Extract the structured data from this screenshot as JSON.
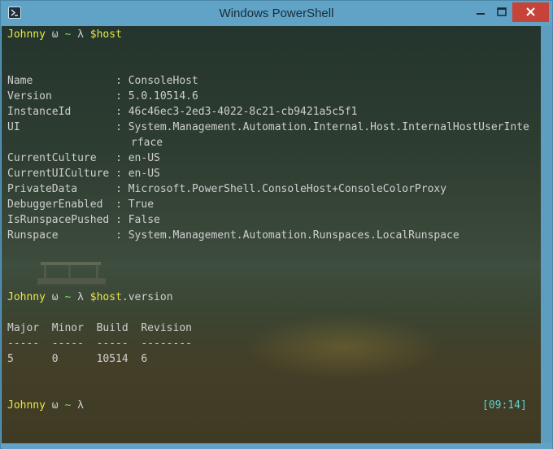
{
  "window": {
    "title": "Windows PowerShell"
  },
  "prompt": {
    "user": "Johnny",
    "omega": "ω",
    "tilde": "~",
    "lambda": "λ"
  },
  "commands": [
    {
      "var": "$host",
      "suffix": ""
    },
    {
      "var": "$host",
      "suffix": ".version"
    }
  ],
  "host_props": [
    {
      "name": "Name             ",
      "value": "ConsoleHost"
    },
    {
      "name": "Version          ",
      "value": "5.0.10514.6"
    },
    {
      "name": "InstanceId       ",
      "value": "46c46ec3-2ed3-4022-8c21-cb9421a5c5f1"
    },
    {
      "name": "UI               ",
      "value": "System.Management.Automation.Internal.Host.InternalHostUserInte"
    },
    {
      "name": "",
      "value": "rface"
    },
    {
      "name": "CurrentCulture   ",
      "value": "en-US"
    },
    {
      "name": "CurrentUICulture ",
      "value": "en-US"
    },
    {
      "name": "PrivateData      ",
      "value": "Microsoft.PowerShell.ConsoleHost+ConsoleColorProxy"
    },
    {
      "name": "DebuggerEnabled  ",
      "value": "True"
    },
    {
      "name": "IsRunspacePushed ",
      "value": "False"
    },
    {
      "name": "Runspace         ",
      "value": "System.Management.Automation.Runspaces.LocalRunspace"
    }
  ],
  "version_table": {
    "header": "Major  Minor  Build  Revision",
    "divider": "-----  -----  -----  --------",
    "row": "5      0      10514  6"
  },
  "clock": "[09:14]",
  "colors": {
    "user": "#e8e646",
    "tilde": "#7fd76a",
    "clock": "#5fd2d2",
    "text": "#cfcfcf"
  }
}
